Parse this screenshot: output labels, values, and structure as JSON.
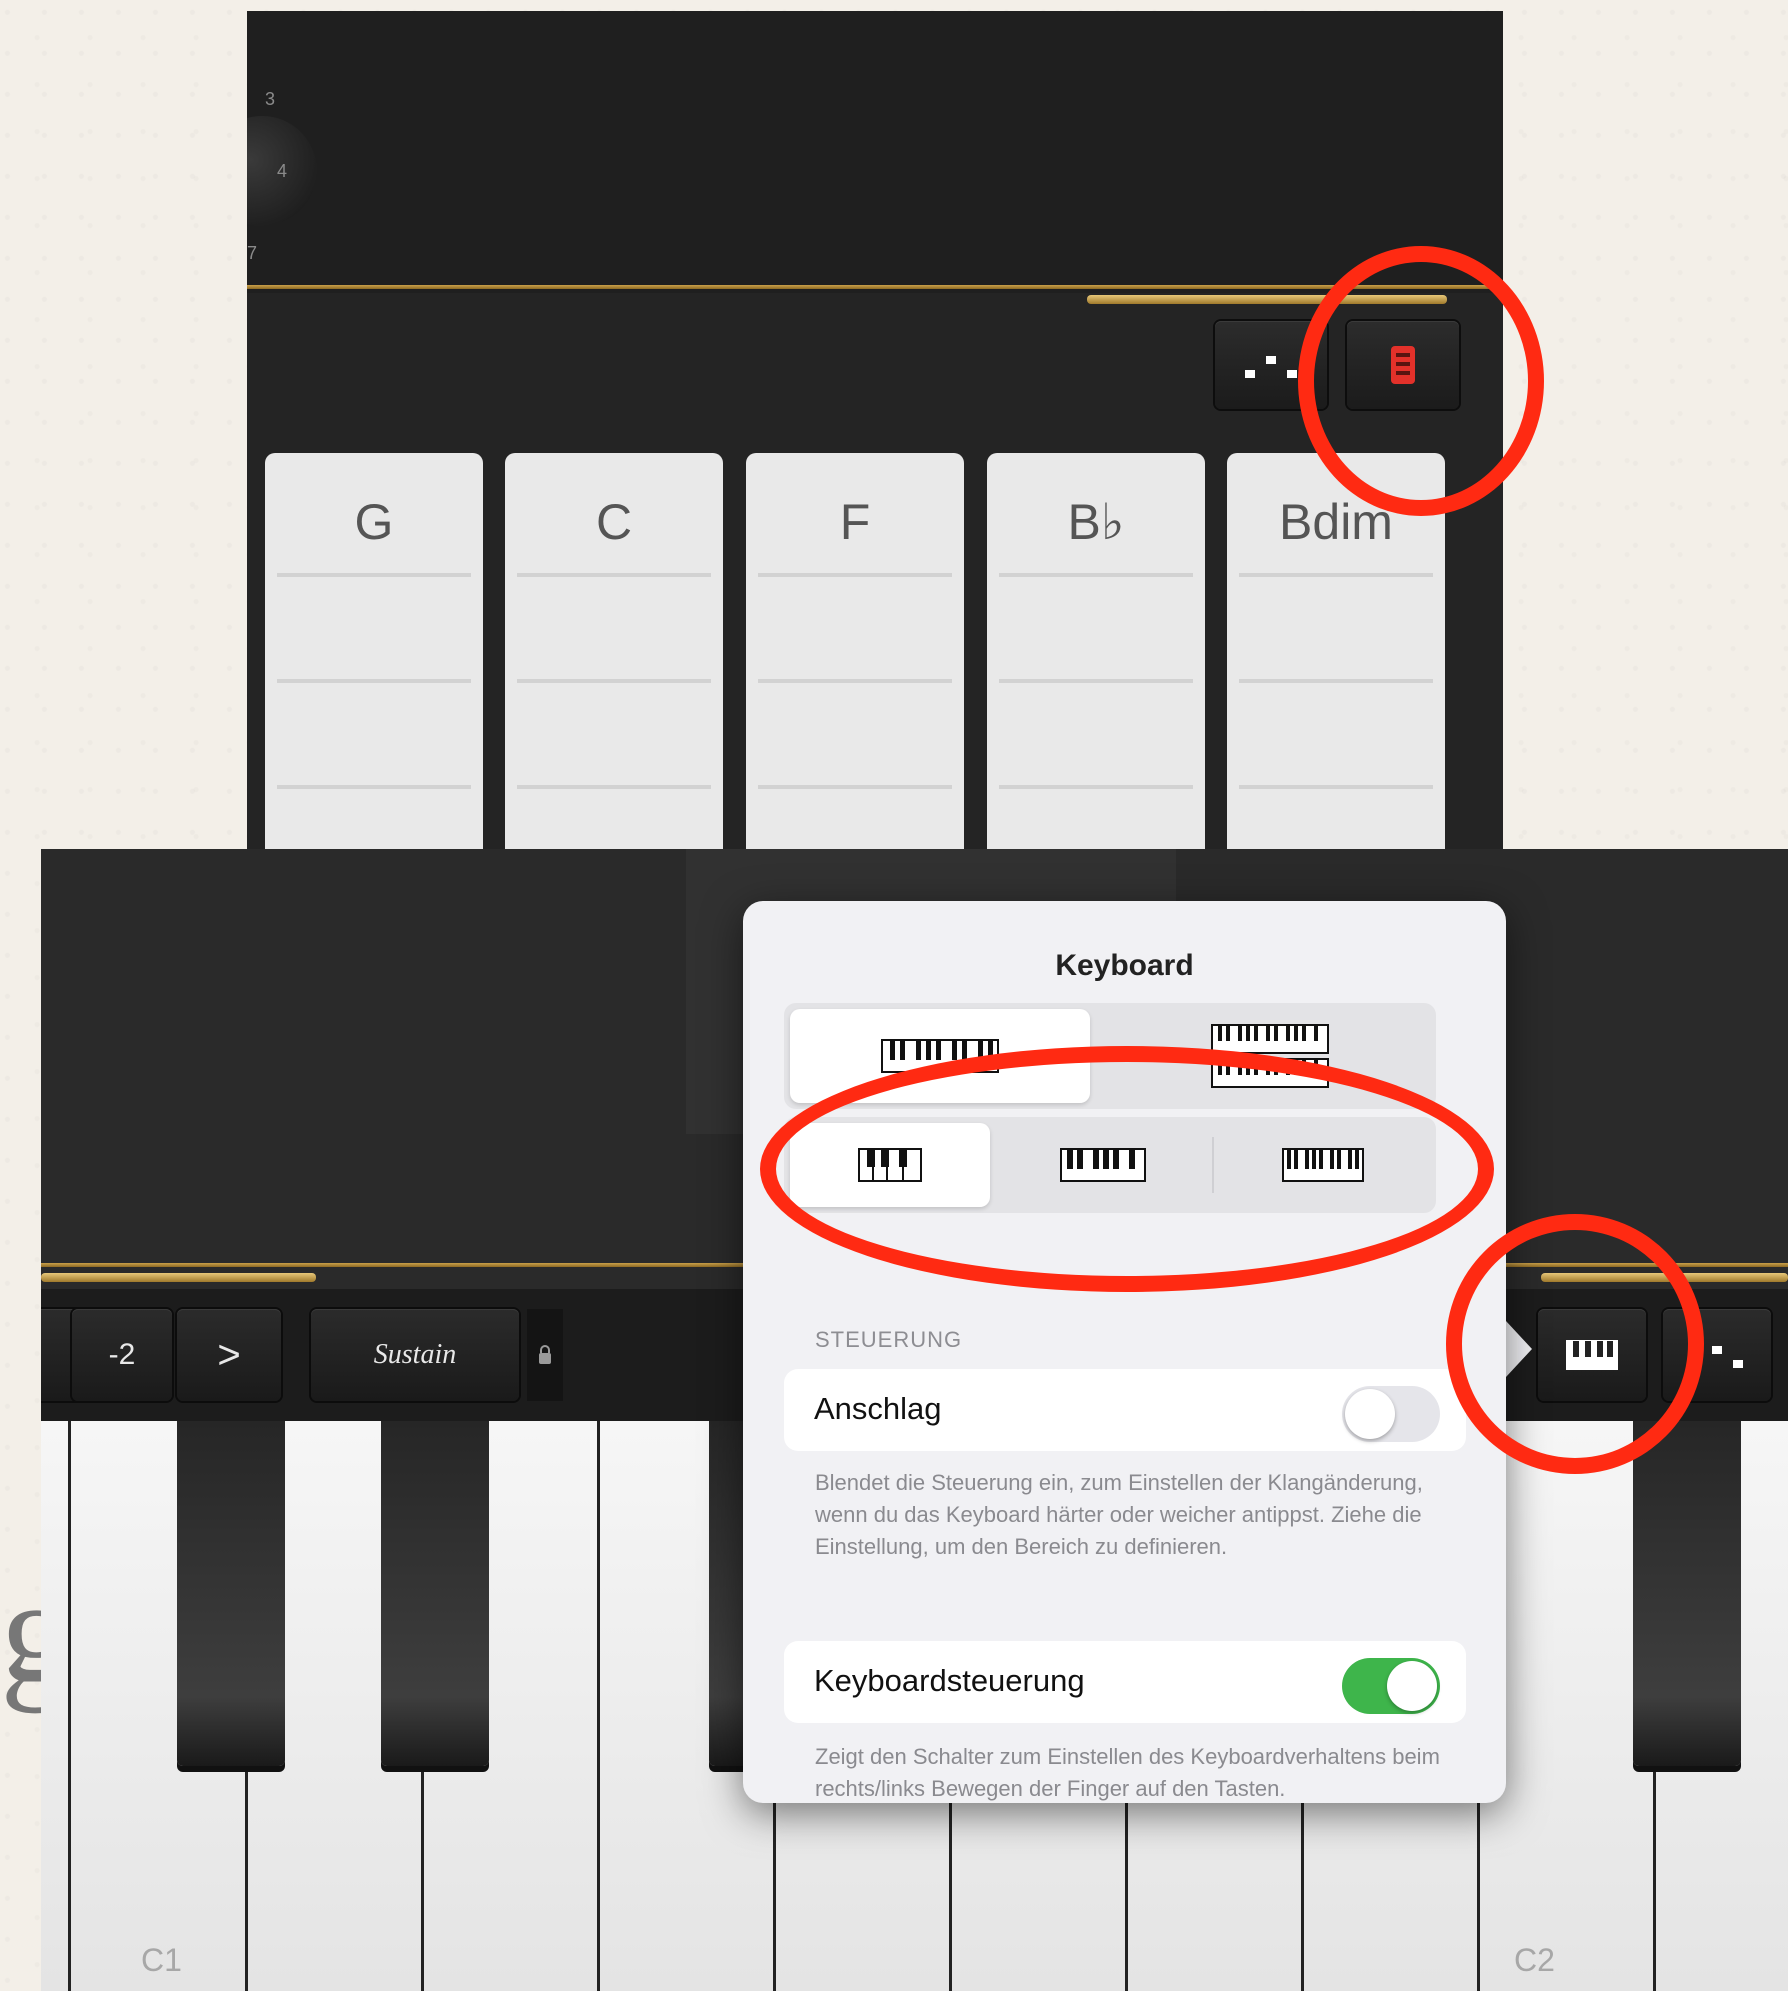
{
  "top_screenshot": {
    "knob_labels": [
      "3",
      "4",
      "7"
    ],
    "chord_strips": [
      {
        "label": "G"
      },
      {
        "label": "C"
      },
      {
        "label": "F"
      },
      {
        "label": "B♭"
      },
      {
        "label": "Bdim"
      }
    ],
    "toolbar": {
      "arpeggiator_button_icon": "arpeggiator-icon",
      "chord_strip_settings_icon": "chord-strip-icon"
    }
  },
  "bottom_screenshot": {
    "controls": {
      "octave_value": "-2",
      "octave_up": ">",
      "sustain_label": "Sustain",
      "keyboard_settings_icon": "keyboard-icon"
    },
    "key_labels": {
      "c1": "C1",
      "c2": "C2"
    },
    "popover": {
      "title": "Keyboard",
      "layout_segments": [
        "single-keyboard-icon",
        "dual-keyboard-icon"
      ],
      "size_segments": [
        "large-keys-icon",
        "medium-keys-icon",
        "small-keys-icon"
      ],
      "section_header": "STEUERUNG",
      "velocity": {
        "label": "Anschlag",
        "enabled": false,
        "description": "Blendet die Steuerung ein, zum Einstellen der Klangänderung, wenn du das Keyboard härter oder weicher antippst. Ziehe die Einstellung, um den Bereich zu definieren."
      },
      "keyboard_control": {
        "label": "Keyboardsteuerung",
        "enabled": true,
        "description": "Zeigt den Schalter zum Einstellen des Keyboardverhaltens beim rechts/links Bewegen der Finger auf den Tasten."
      }
    }
  },
  "background_text": "g.",
  "annotation_color": "#ff2a12"
}
